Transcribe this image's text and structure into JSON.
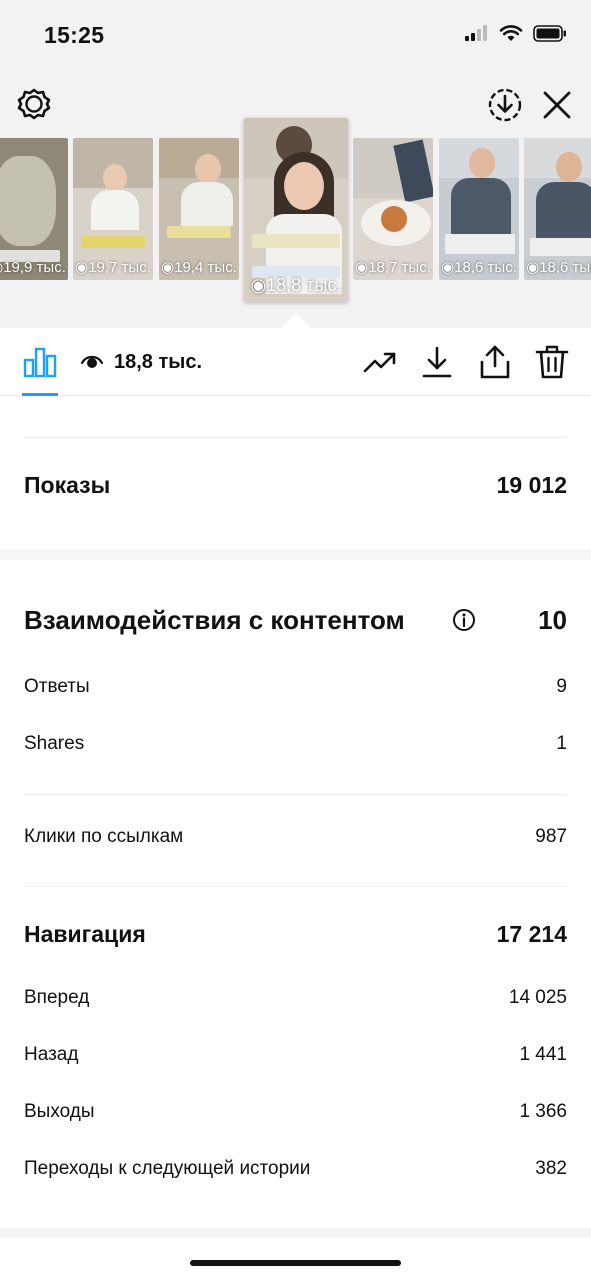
{
  "status_bar": {
    "time": "15:25",
    "icons": [
      "cellular-signal-icon",
      "wifi-icon",
      "battery-icon"
    ]
  },
  "top_bar": {
    "icons": [
      "settings-icon",
      "save-icon",
      "close-icon"
    ]
  },
  "stories": [
    {
      "views": "19,9 тыс."
    },
    {
      "views": "19,7 тыс."
    },
    {
      "views": "19,4 тыс."
    },
    {
      "views": "18,8 тыс.",
      "active": true
    },
    {
      "views": "18,7 тыс."
    },
    {
      "views": "18,6 тыс."
    },
    {
      "views": "18,6 тыс."
    }
  ],
  "toolbar": {
    "views": "18,8 тыс.",
    "icons": [
      "insights-icon",
      "eye-icon",
      "promote-icon",
      "download-icon",
      "share-icon",
      "delete-icon"
    ],
    "accent_color": "#1fa1f1"
  },
  "stats": {
    "impressions": {
      "label": "Показы",
      "value": "19 012"
    },
    "interactions": {
      "label": "Взаимодействия с контентом",
      "value": "10",
      "items": [
        {
          "label": "Ответы",
          "value": "9"
        },
        {
          "label": "Shares",
          "value": "1"
        }
      ]
    },
    "link_clicks": {
      "label": "Клики по ссылкам",
      "value": "987"
    },
    "navigation": {
      "label": "Навигация",
      "value": "17 214",
      "items": [
        {
          "label": "Вперед",
          "value": "14 025"
        },
        {
          "label": "Назад",
          "value": "1 441"
        },
        {
          "label": "Выходы",
          "value": "1 366"
        },
        {
          "label": "Переходы к следующей истории",
          "value": "382"
        }
      ]
    }
  }
}
